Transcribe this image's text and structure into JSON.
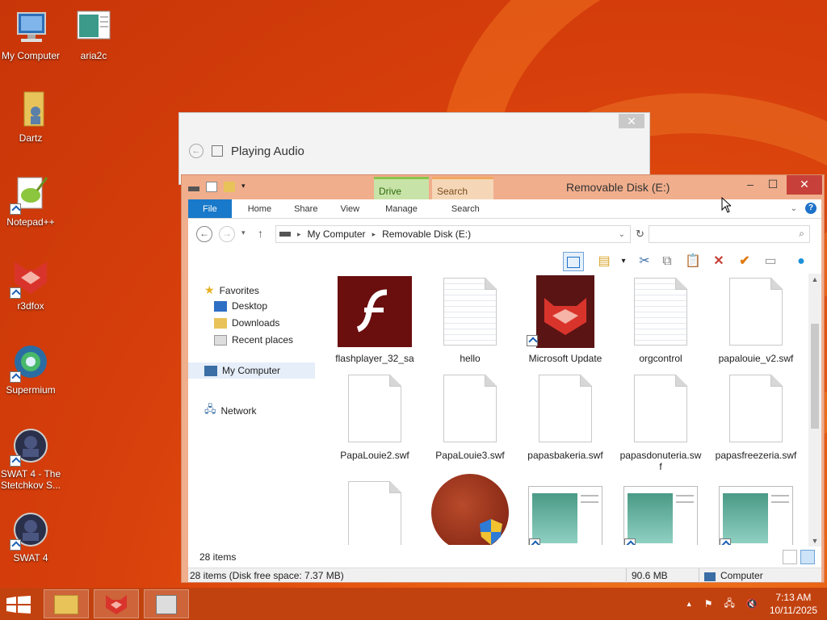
{
  "desktop": {
    "icons": [
      {
        "label": "My Computer"
      },
      {
        "label": "aria2c"
      },
      {
        "label": "Dartz"
      },
      {
        "label": "Notepad++"
      },
      {
        "label": "r3dfox"
      },
      {
        "label": "Supermium"
      },
      {
        "label": "SWAT 4 - The Stetchkov S..."
      },
      {
        "label": "SWAT 4"
      }
    ]
  },
  "back_window": {
    "title": "Playing Audio",
    "close_glyph": "✕"
  },
  "explorer": {
    "title": "Removable Disk (E:)",
    "context_tabs": {
      "drive": "Drive Tools",
      "search": "Search Tools"
    },
    "ribbon_tabs": [
      "File",
      "Home",
      "Share",
      "View",
      "Manage",
      "Search"
    ],
    "address": {
      "root": "My Computer",
      "current": "Removable Disk (E:)"
    },
    "search_placeholder": "",
    "nav": {
      "favorites": "Favorites",
      "desktop": "Desktop",
      "downloads": "Downloads",
      "recent": "Recent places",
      "computer": "My Computer",
      "network": "Network"
    },
    "files": [
      {
        "name": "flashplayer_32_sa"
      },
      {
        "name": "hello"
      },
      {
        "name": "Microsoft Update"
      },
      {
        "name": "orgcontrol"
      },
      {
        "name": "papalouie_v2.swf"
      },
      {
        "name": "PapaLouie2.swf"
      },
      {
        "name": "PapaLouie3.swf"
      },
      {
        "name": "papasbakeria.swf"
      },
      {
        "name": "papasdonuteria.swf"
      },
      {
        "name": "papasfreezeria.swf"
      },
      {
        "name": ""
      },
      {
        "name": ""
      },
      {
        "name": ""
      },
      {
        "name": ""
      },
      {
        "name": ""
      }
    ],
    "items_count": "28 items",
    "status": {
      "summary": "28 items (Disk free space: 7.37 MB)",
      "size": "90.6 MB",
      "location": "Computer"
    }
  },
  "taskbar": {
    "time": "7:13 AM",
    "date": "10/11/2025"
  },
  "colors": {
    "accent": "#1979ca",
    "titlebar": "#f0ae8c",
    "close": "#c7413a",
    "taskbar": "#c2420f"
  }
}
